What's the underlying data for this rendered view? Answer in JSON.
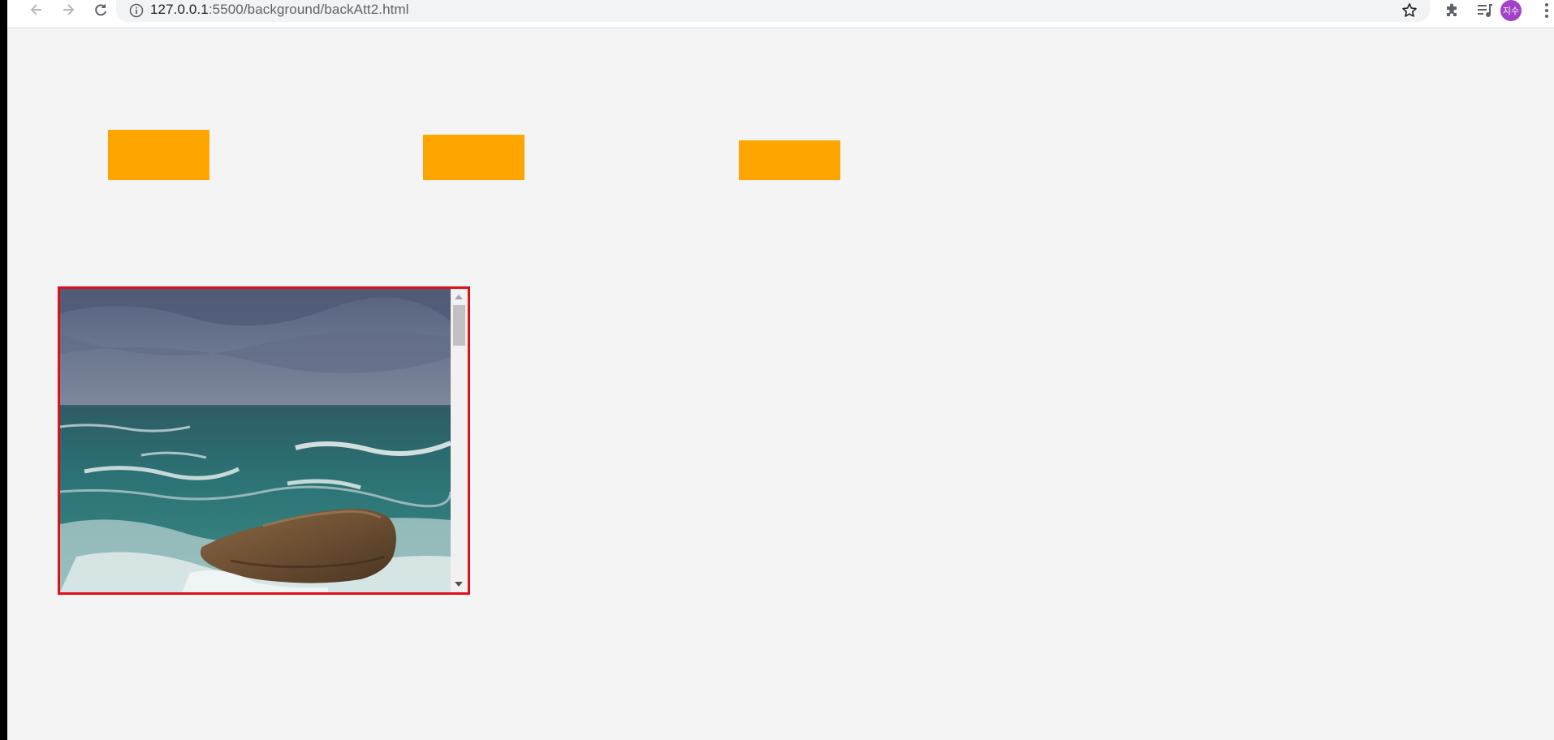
{
  "browser": {
    "url_host": "127.0.0.1",
    "url_path": ":5500/background/backAtt2.html",
    "profile_initials": "지수",
    "profile_color": "#a142c9"
  },
  "icons": {
    "back": "arrow-left-icon",
    "forward": "arrow-right-icon",
    "reload": "reload-icon",
    "info": "info-icon",
    "bookmark": "star-icon",
    "extensions": "puzzle-icon",
    "media": "playlist-icon",
    "menu": "kebab-menu-icon"
  },
  "page": {
    "background_color": "#f4f4f4",
    "box_color": "#ffa500",
    "scroll_box_border_color": "#e00f17",
    "scroll_box_image": "stormy sea with rock"
  }
}
